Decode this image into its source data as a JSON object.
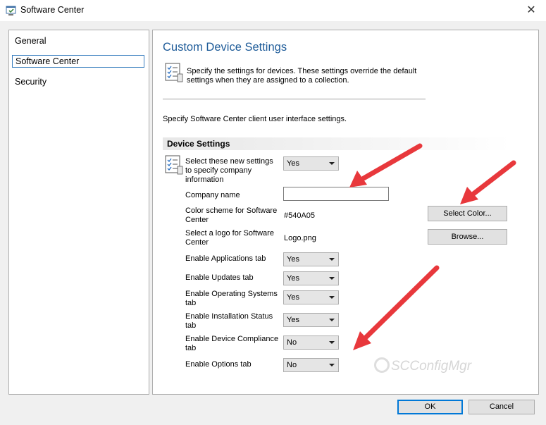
{
  "window": {
    "title": "Software Center",
    "close_glyph": "✕"
  },
  "sidebar": {
    "items": [
      {
        "label": "General",
        "selected": false
      },
      {
        "label": "Software Center",
        "selected": true
      },
      {
        "label": "Security",
        "selected": false
      }
    ]
  },
  "main": {
    "title": "Custom Device Settings",
    "intro": "Specify the settings for devices. These settings override the default settings when they are assigned to a collection.",
    "subtitle": "Specify Software Center client user interface settings.",
    "section": "Device Settings",
    "settings": {
      "select_new": {
        "label": "Select these new settings to specify company information",
        "value": "Yes"
      },
      "company_name": {
        "label": "Company name",
        "value": ""
      },
      "color_scheme": {
        "label": "Color scheme for Software Center",
        "value": "#540A05",
        "button": "Select Color..."
      },
      "logo": {
        "label": "Select a logo for Software Center",
        "value": "Logo.png",
        "button": "Browse..."
      },
      "applications_tab": {
        "label": "Enable Applications tab",
        "value": "Yes"
      },
      "updates_tab": {
        "label": "Enable Updates tab",
        "value": "Yes"
      },
      "os_tab": {
        "label": "Enable Operating Systems tab",
        "value": "Yes"
      },
      "install_status_tab": {
        "label": "Enable Installation Status tab",
        "value": "Yes"
      },
      "device_compliance_tab": {
        "label": "Enable Device Compliance tab",
        "value": "No"
      },
      "options_tab": {
        "label": "Enable Options tab",
        "value": "No"
      }
    },
    "watermark": "SCConfigMgr"
  },
  "footer": {
    "ok": "OK",
    "cancel": "Cancel"
  },
  "colors": {
    "title_blue": "#1f5c99",
    "arrow_red": "#e8383c",
    "default_button_border": "#0078d7"
  },
  "icons": [
    "window-icon",
    "close-icon",
    "settings-list-icon",
    "combo-arrow-icon"
  ]
}
